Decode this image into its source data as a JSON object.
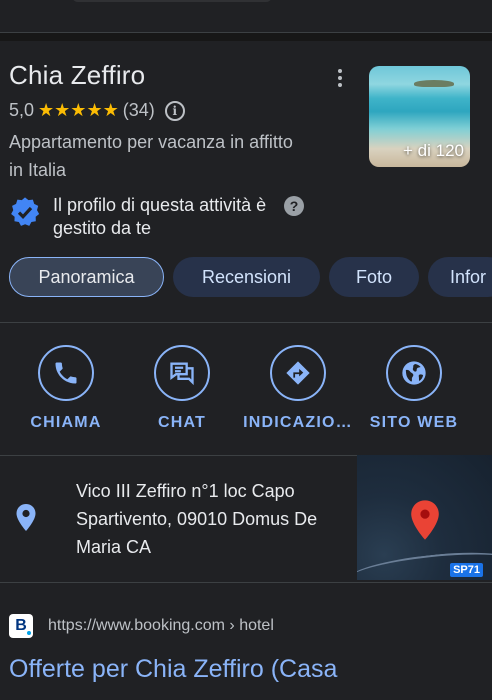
{
  "place": {
    "name": "Chia Zeffiro",
    "rating": "5,0",
    "stars": "★★★★★",
    "reviews_count": "(34)",
    "category": "Appartamento per vacanza in affitto in Italia",
    "photo_count": "+ di 120",
    "managed_text": "Il profilo di questa attività è gestito da te"
  },
  "tabs": [
    {
      "label": "Panoramica",
      "active": true
    },
    {
      "label": "Recensioni"
    },
    {
      "label": "Foto"
    },
    {
      "label": "Infor"
    }
  ],
  "actions": [
    {
      "label": "CHIAMA",
      "icon": "phone-icon"
    },
    {
      "label": "CHAT",
      "icon": "chat-icon"
    },
    {
      "label": "INDICAZIO…",
      "icon": "directions-icon"
    },
    {
      "label": "SITO WEB",
      "icon": "globe-icon"
    }
  ],
  "address": {
    "text": "Vico III Zeffiro n°1 loc Capo Spartivento, 09010 Domus De Maria CA",
    "map_road_label": "SP71"
  },
  "search_result": {
    "favicon_letter": "B",
    "url_domain": "https://www.booking.com",
    "url_path": " › hotel",
    "title": "Offerte per Chia Zeffiro (Casa"
  },
  "colors": {
    "background": "#202124",
    "accent": "#8ab4f8",
    "star": "#fbbc04",
    "verified": "#4285f4",
    "map_marker": "#ea4335"
  }
}
